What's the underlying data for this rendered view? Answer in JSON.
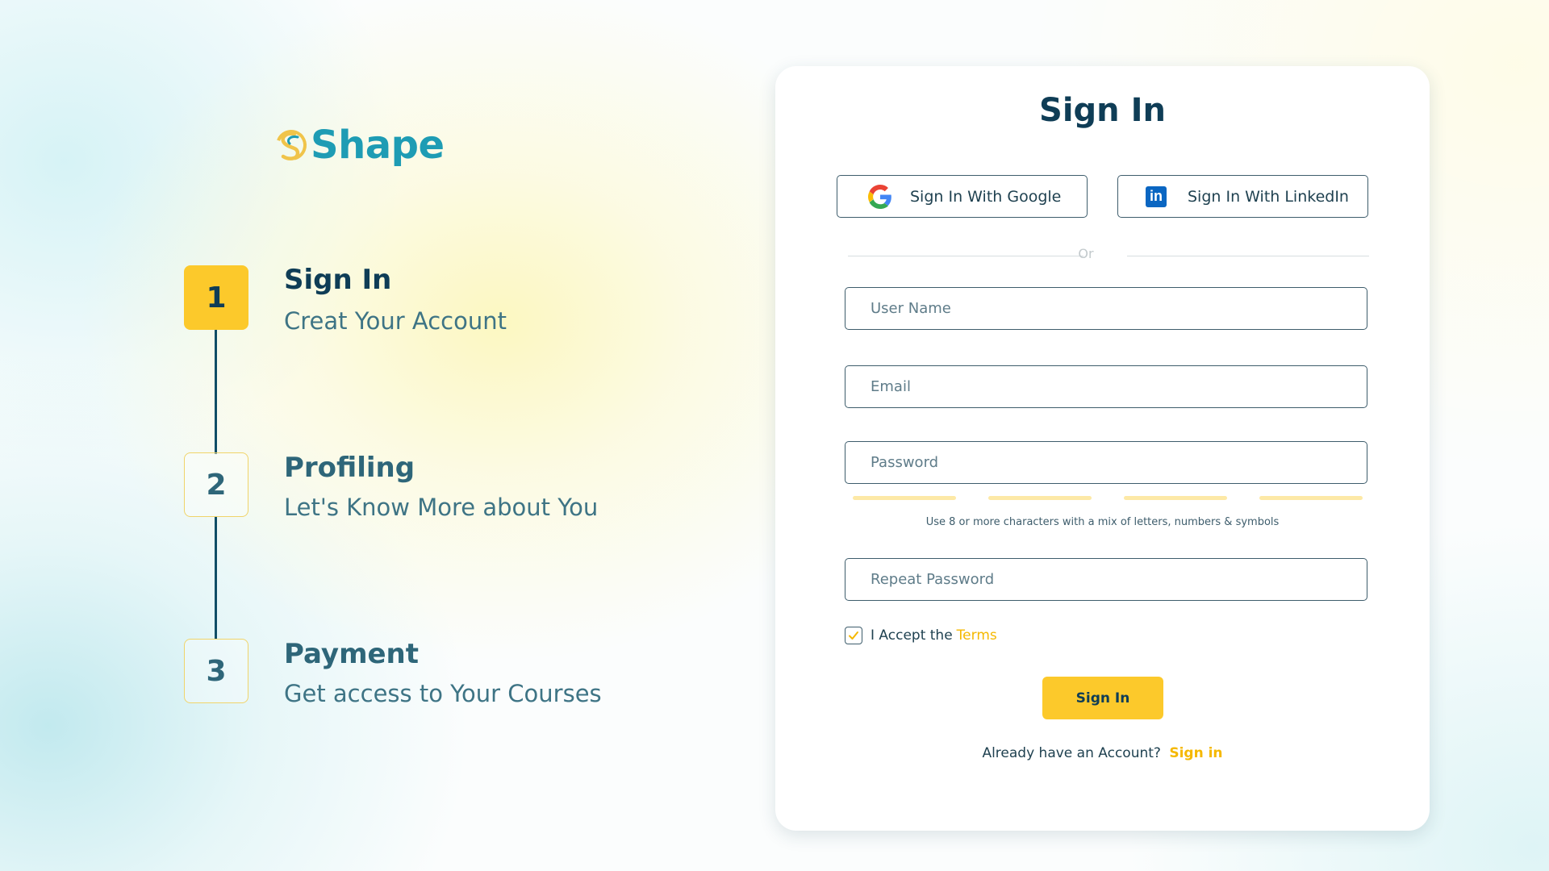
{
  "brand": {
    "name": "Shape"
  },
  "steps": [
    {
      "number": "1",
      "title": "Sign In",
      "subtitle": "Creat Your Account",
      "state": "active"
    },
    {
      "number": "2",
      "title": "Profiling",
      "subtitle": "Let's Know More about You",
      "state": "inactive"
    },
    {
      "number": "3",
      "title": "Payment",
      "subtitle": "Get access to Your Courses",
      "state": "inactive"
    }
  ],
  "form": {
    "title": "Sign In",
    "social": {
      "google_label": "Sign In With Google",
      "linkedin_label": "Sign In With LinkedIn"
    },
    "divider_text": "Or",
    "fields": {
      "username_placeholder": "User Name",
      "email_placeholder": "Email",
      "password_placeholder": "Password",
      "repeat_password_placeholder": "Repeat Password"
    },
    "password_hint": "Use 8 or more characters with a mix of letters, numbers & symbols",
    "terms": {
      "prefix": "I Accept the",
      "link": "Terms",
      "checked": true
    },
    "submit_label": "Sign In",
    "footer": {
      "text": "Already have an Account?",
      "link": "Sign in"
    }
  },
  "colors": {
    "primary_yellow": "#fcc92b",
    "dark_navy": "#0f3d56",
    "brand_teal": "#1e9cb4",
    "link_yellow": "#f5b800",
    "linkedin_blue": "#0a66c2"
  }
}
